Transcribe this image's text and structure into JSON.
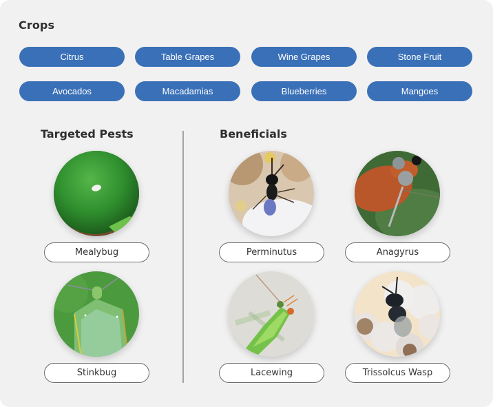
{
  "crops": {
    "title": "Crops",
    "items": [
      {
        "label": "Citrus"
      },
      {
        "label": "Table Grapes"
      },
      {
        "label": "Wine Grapes"
      },
      {
        "label": "Stone Fruit"
      },
      {
        "label": "Avocados"
      },
      {
        "label": "Macadamias"
      },
      {
        "label": "Blueberries"
      },
      {
        "label": "Mangoes"
      }
    ],
    "button_color": "#3a70b7"
  },
  "targeted_pests": {
    "title": "Targeted Pests",
    "items": [
      {
        "label": "Mealybug",
        "image": "mealybug-on-citrus-photo"
      },
      {
        "label": "Stinkbug",
        "image": "green-stinkbug-photo"
      }
    ]
  },
  "beneficials": {
    "title": "Beneficials",
    "items": [
      {
        "label": "Perminutus",
        "image": "perminutus-wasp-photo"
      },
      {
        "label": "Anagyrus",
        "image": "anagyrus-wasp-photo"
      },
      {
        "label": "Lacewing",
        "image": "green-lacewing-photo"
      },
      {
        "label": "Trissolcus Wasp",
        "image": "trissolcus-wasp-on-eggs-photo"
      }
    ]
  }
}
